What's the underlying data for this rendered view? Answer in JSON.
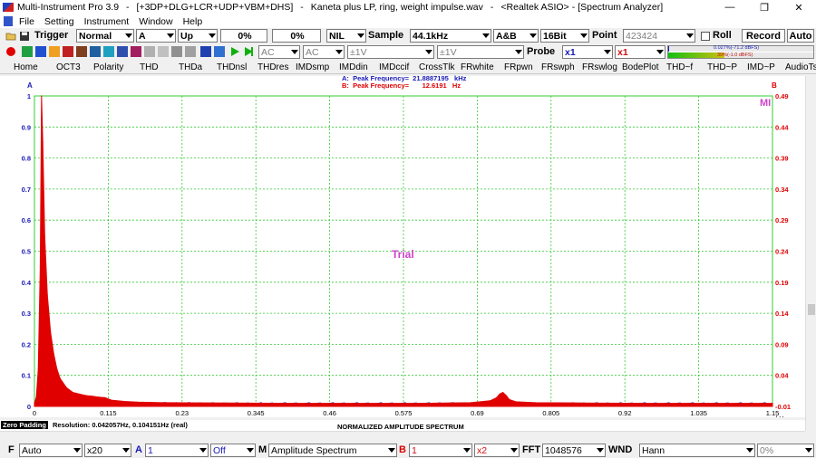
{
  "window": {
    "app_title": "Multi-Instrument Pro 3.9",
    "modules": "[+3DP+DLG+LCR+UDP+VBM+DHS]",
    "file": "Kaneta plus LP, ring, weight impulse.wav",
    "device": "<Realtek ASIO>",
    "view": "[Spectrum Analyzer]",
    "separator": "-",
    "controls": {
      "minimize": "—",
      "restore": "❐",
      "close": "✕"
    }
  },
  "menu": [
    "File",
    "Setting",
    "Instrument",
    "Window",
    "Help"
  ],
  "toolbar1": {
    "trigger_label": "Trigger",
    "trigger_mode": "Normal",
    "trigger_channel": "A",
    "trigger_edge": "Up",
    "trigger_level": "0%",
    "trigger_delay": "0%",
    "trigger_filter": "NIL",
    "sample_label": "Sample",
    "sample_rate": "44.1kHz",
    "channels": "A&B",
    "bits": "16Bit",
    "point_label": "Point",
    "point_value": "423424",
    "roll_label": "Roll",
    "record_label": "Record",
    "auto_label": "Auto"
  },
  "toolbar2": {
    "coupling_a": "AC",
    "coupling_b": "AC",
    "range_a": "±1V",
    "range_b": "±1V",
    "probe_label": "Probe",
    "probe_a": "x1",
    "probe_b": "x1",
    "level_a_text": "0.027%(-71.2 dBFS)",
    "level_b_text": "39%(-1.0 dBFS)",
    "level_a_fraction": 0.003,
    "level_b_fraction": 0.39
  },
  "tabs": [
    "Home",
    "OCT3",
    "Polarity",
    "THD",
    "THDa",
    "THDnsl",
    "THDres",
    "IMDsmp",
    "IMDdin",
    "IMDccif",
    "CrossTlk",
    "FRwhite",
    "FRpwn",
    "FRswph",
    "FRswlog",
    "BodePlot",
    "THD~f",
    "THD~P",
    "IMD~P",
    "AudioTst"
  ],
  "plot": {
    "label_a": "A",
    "label_b": "B",
    "peak_a": "A:  Peak Frequency=  21.8887195   kHz",
    "peak_b": "B:  Peak Frequency=       12.6191   Hz",
    "watermark": "Trial",
    "corner_label": "MI",
    "x_unit": "kHz",
    "x_title": "NORMALIZED AMPLITUDE SPECTRUM",
    "colors": {
      "grid": "#33cc33",
      "channel_a": "#1a1ab8",
      "channel_b": "#e00000",
      "watermark": "#cc44cc"
    }
  },
  "chart_data": {
    "type": "line",
    "title": "NORMALIZED AMPLITUDE SPECTRUM",
    "xlabel": "kHz",
    "ylabel": "",
    "xlim": [
      0,
      1.15
    ],
    "ylim_left": [
      0,
      1
    ],
    "ylim_right": [
      -0.01,
      0.49
    ],
    "x_ticks": [
      "0",
      "0.115",
      "0.23",
      "0.345",
      "0.46",
      "0.575",
      "0.69",
      "0.805",
      "0.92",
      "1.035",
      "1.15"
    ],
    "y_ticks_left": [
      "0",
      "0.1",
      "0.2",
      "0.3",
      "0.4",
      "0.5",
      "0.6",
      "0.7",
      "0.8",
      "0.9",
      "1"
    ],
    "y_ticks_right": [
      "-0.01",
      "0.04",
      "0.09",
      "0.14",
      "0.19",
      "0.24",
      "0.29",
      "0.34",
      "0.39",
      "0.44",
      "0.49"
    ],
    "grid": true,
    "series": [
      {
        "name": "B",
        "x": [
          0,
          0.003,
          0.006,
          0.009,
          0.011,
          0.013,
          0.016,
          0.02,
          0.025,
          0.03,
          0.035,
          0.04,
          0.05,
          0.06,
          0.07,
          0.08,
          0.09,
          0.1,
          0.11,
          0.12,
          0.14,
          0.16,
          0.2,
          0.3,
          0.4,
          0.5,
          0.6,
          0.68,
          0.71,
          0.72,
          0.725,
          0.73,
          0.735,
          0.74,
          0.75,
          0.78,
          0.85,
          0.95,
          1.05,
          1.15
        ],
        "values": [
          0.01,
          0.03,
          0.12,
          0.45,
          1.0,
          0.85,
          0.55,
          0.36,
          0.24,
          0.17,
          0.12,
          0.09,
          0.06,
          0.045,
          0.04,
          0.035,
          0.033,
          0.03,
          0.028,
          0.02,
          0.016,
          0.014,
          0.012,
          0.011,
          0.01,
          0.01,
          0.01,
          0.012,
          0.018,
          0.028,
          0.04,
          0.045,
          0.035,
          0.022,
          0.015,
          0.012,
          0.011,
          0.01,
          0.01,
          0.01
        ]
      },
      {
        "name": "A",
        "x": [
          0,
          0.1,
          0.2,
          0.3,
          0.4,
          0.5,
          0.6,
          0.7,
          0.8,
          0.9,
          1.0,
          1.1,
          1.15
        ],
        "values": [
          0.008,
          0.007,
          0.007,
          0.006,
          0.006,
          0.006,
          0.006,
          0.007,
          0.006,
          0.006,
          0.006,
          0.006,
          0.006
        ]
      }
    ]
  },
  "status": {
    "zero_padding": "Zero Padding",
    "resolution": "Resolution: 0.042057Hz, 0.104151Hz (real)"
  },
  "bottom": {
    "f_label": "F",
    "f_value": "Auto",
    "zoom": "x20",
    "a_label": "A",
    "a_value": "1",
    "a_mode": "Off",
    "m_label": "M",
    "m_value": "Amplitude Spectrum",
    "b_label": "B",
    "b_value": "1",
    "b_zoom": "x2",
    "fft_label": "FFT",
    "fft_value": "1048576",
    "wnd_label": "WND",
    "wnd_value": "Hann",
    "pct": "0%"
  }
}
